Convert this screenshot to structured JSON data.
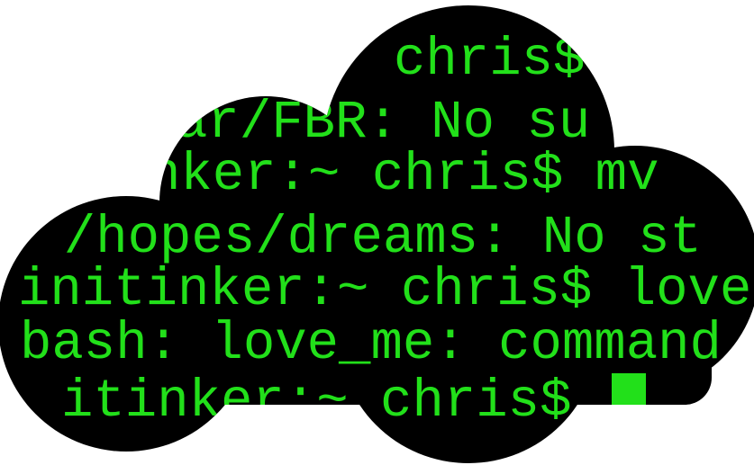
{
  "terminal": {
    "text_color": "#22e01a",
    "background_color": "#000000",
    "lines": [
      {
        "text": "chris$"
      },
      {
        "text": "ar/FBR: No su"
      },
      {
        "text": "nker:~ chris$ mv"
      },
      {
        "text": ". /hopes/dreams: No st"
      },
      {
        "text": "initinker:~ chris$ love"
      },
      {
        "text": "bash: love_me: command"
      },
      {
        "text": "itinker:~ chris$"
      }
    ],
    "cursor": {
      "shape": "block",
      "color": "#22e01a"
    }
  }
}
